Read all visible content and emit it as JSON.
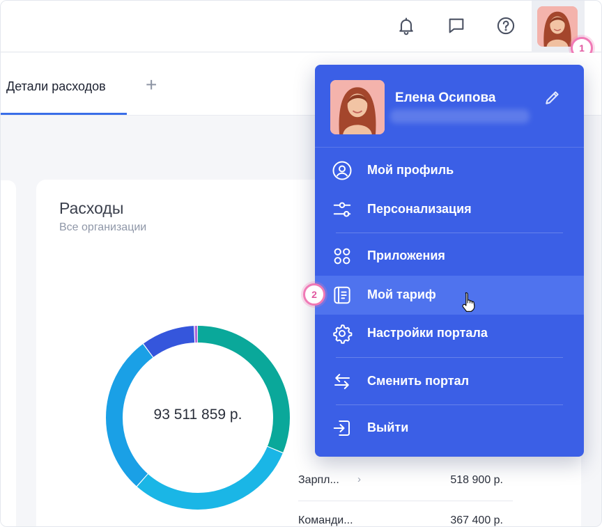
{
  "topbar": {
    "icons": [
      "bell-icon",
      "chat-icon",
      "help-icon"
    ],
    "badge_1": "1"
  },
  "tabs": {
    "active_label": "Детали расходов",
    "add_label": "+"
  },
  "card": {
    "title": "Расходы",
    "subtitle": "Все организации",
    "total": "93 511 859 р.",
    "rows": [
      {
        "name": "Зарпл...",
        "amount": "518 900 р."
      },
      {
        "name": "Команди...",
        "amount": "367 400 р."
      }
    ]
  },
  "chart_data": {
    "type": "pie",
    "title": "Расходы",
    "subtitle": "Все организации",
    "center_label": "93 511 859 р.",
    "slices": [
      {
        "value": 31,
        "color": "#0aa89a"
      },
      {
        "value": 30,
        "color": "#1ab6e6"
      },
      {
        "value": 28,
        "color": "#1aa0e6"
      },
      {
        "value": 9.4,
        "color": "#3556dc"
      },
      {
        "value": 0.6,
        "color": "#b06ad8"
      }
    ]
  },
  "menu": {
    "user_name": "Елена Осипова",
    "items": [
      {
        "label": "Мой профиль",
        "icon": "user-circle-icon"
      },
      {
        "label": "Персонализация",
        "icon": "sliders-icon"
      },
      {
        "label": "Приложения",
        "icon": "apps-grid-icon"
      },
      {
        "label": "Мой тариф",
        "icon": "tariff-icon"
      },
      {
        "label": "Настройки портала",
        "icon": "gear-icon"
      },
      {
        "label": "Сменить портал",
        "icon": "switch-arrows-icon"
      },
      {
        "label": "Выйти",
        "icon": "logout-icon"
      }
    ],
    "badge_2": "2"
  },
  "colors": {
    "menu_bg": "#3b5fe6",
    "menu_active": "#4f73ee",
    "accent": "#3a6ee8",
    "badge": "#f07ab6"
  }
}
